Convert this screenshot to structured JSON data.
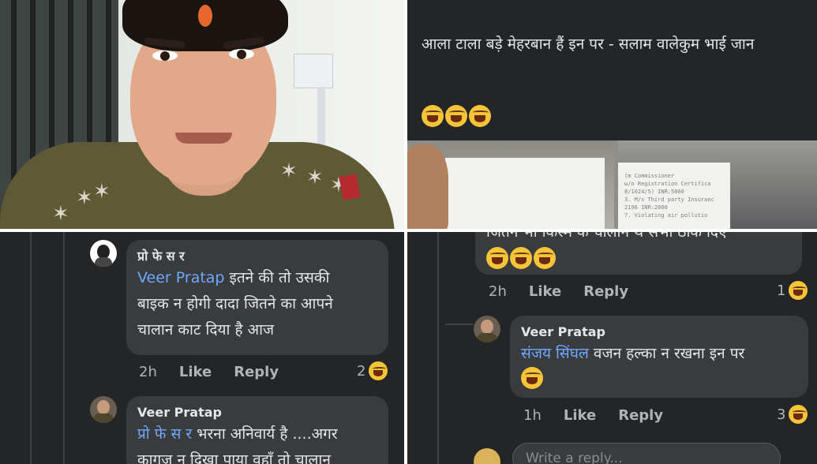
{
  "post": {
    "text": "आला टाला बड़े मेहरबान हैं इन पर - सलाम वालेकुम भाई जान",
    "emoji_icon": "laughing-tears-emoji"
  },
  "paper_slip": {
    "lines": [
      "(m Commissioner",
      "w/o Registration Certifica",
      "8/1024/5) INR:5000",
      "3. M/s Third party Insuranc",
      "2196 INR:2000",
      "7. Violating air pollutio"
    ]
  },
  "comment1": {
    "author": "प्रो फे स र",
    "mention": "Veer Pratap",
    "text_line1": " इतने की तो उसकी",
    "text_line2": "बाइक न होगी दादा जितने का आपने",
    "text_line3": "चालान काट दिया है आज",
    "time": "2h",
    "like_label": "Like",
    "reply_label": "Reply",
    "reaction_count": "2"
  },
  "comment2": {
    "author": "Veer Pratap",
    "mention": "प्रो फे स र",
    "text_line1": " भरना अनिवार्य है ....अगर",
    "text_line2": "कागज न दिखा पाया वहाँ तो चालान"
  },
  "comment3": {
    "text_top": "जितने भी किस्म के चालान थे सभी ठोक दिए",
    "time": "2h",
    "like_label": "Like",
    "reply_label": "Reply",
    "reaction_count": "1"
  },
  "comment4": {
    "author": "Veer Pratap",
    "mention": "संजय सिंघल",
    "text": " वजन हल्का न रखना इन पर",
    "time": "1h",
    "like_label": "Like",
    "reply_label": "Reply",
    "reaction_count": "3"
  },
  "reply_box": {
    "placeholder": "Write a reply..."
  },
  "colors": {
    "background_dark": "#242526",
    "bubble": "#3a3b3c",
    "mention": "#6ea8ff",
    "secondary_text": "#b0b3b8"
  }
}
